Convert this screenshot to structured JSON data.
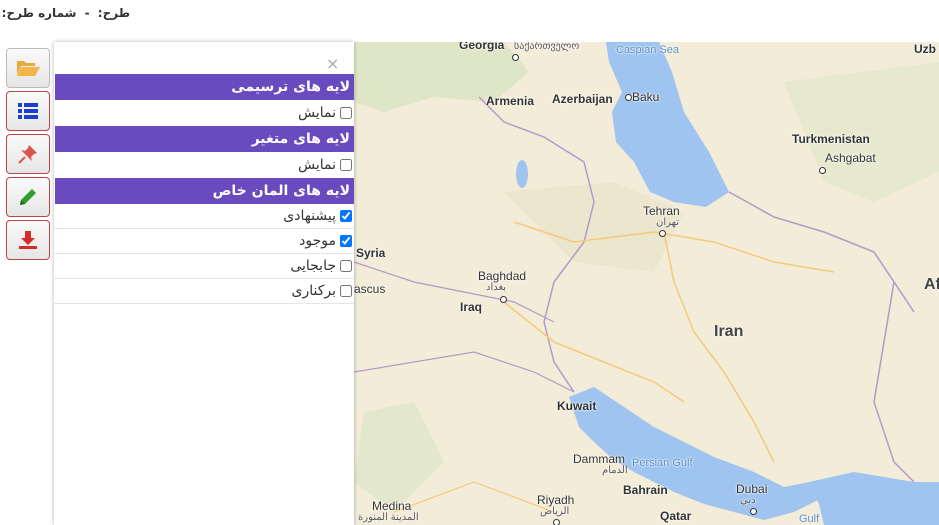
{
  "header": {
    "plan_label": "طرح:",
    "plan_value": "-",
    "plan_number_label": "شماره طرح:"
  },
  "toolbar": {
    "buttons": [
      {
        "icon": "folder-open-icon"
      },
      {
        "icon": "list-icon"
      },
      {
        "icon": "pushpin-icon"
      },
      {
        "icon": "pencil-icon"
      },
      {
        "icon": "download-icon"
      }
    ]
  },
  "panel": {
    "close_label": "×",
    "sections": [
      {
        "title": "لایه های ترسیمی",
        "items": [
          {
            "label": "نمایش",
            "checked": false
          }
        ]
      },
      {
        "title": "لایه های متغیر",
        "items": [
          {
            "label": "نمایش",
            "checked": false
          }
        ]
      },
      {
        "title": "لایه های المان خاص",
        "items": [
          {
            "label": "پیشنهادی",
            "checked": true
          },
          {
            "label": "موجود",
            "checked": true
          },
          {
            "label": "جابجایی",
            "checked": false
          },
          {
            "label": "برکناری",
            "checked": false
          }
        ]
      }
    ]
  },
  "map": {
    "labels": {
      "georgia": "Georgia",
      "georgia_local": "საქართველო",
      "caspian": "Caspian Sea",
      "uzb": "Uzb",
      "armenia": "Armenia",
      "azerbaijan": "Azerbaijan",
      "baku": "Baku",
      "turkmenistan": "Turkmenistan",
      "ashgabat": "Ashgabat",
      "tehran": "Tehran",
      "tehran_local": "تهران",
      "syria": "Syria",
      "baghdad": "Baghdad",
      "baghdad_local": "بغداد",
      "damascus": "ascus",
      "iraq": "Iraq",
      "iran": "Iran",
      "af": "Af",
      "kuwait": "Kuwait",
      "dammam": "Dammam",
      "dammam_local": "الدمام",
      "persian_gulf": "Persian Gulf",
      "bahrain": "Bahrain",
      "riyadh": "Riyadh",
      "riyadh_local": "الرياض",
      "medina": "Medina",
      "medina_local": "المدينة المنورة",
      "dubai": "Dubai",
      "dubai_local": "دبي",
      "qatar": "Qatar",
      "gulf": "Gulf"
    }
  }
}
